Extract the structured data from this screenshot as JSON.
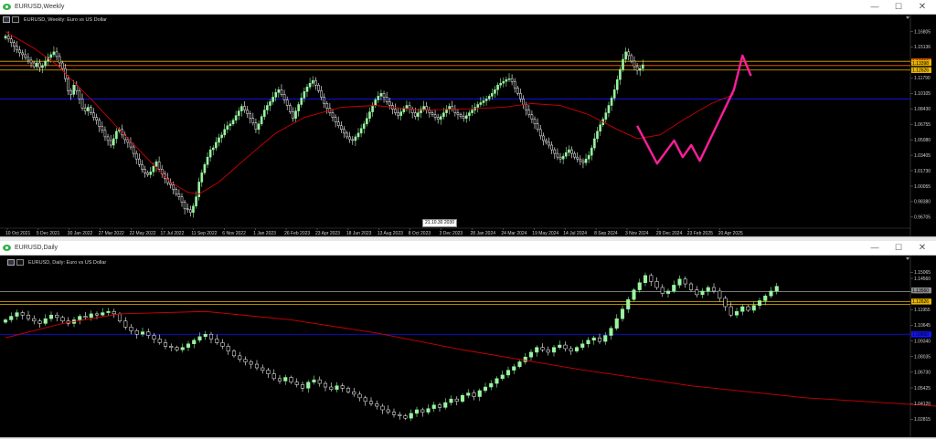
{
  "windows": [
    {
      "title": "EURUSD,Weekly",
      "header": "EURUSD, Weekly: Euro vs US Dollar",
      "controls": {
        "minimize": "—",
        "maximize": "☐",
        "close": "✕"
      },
      "time_tooltip": {
        "date": "21.10.30",
        "value": "2030"
      }
    },
    {
      "title": "EURUSD,Daily",
      "header": "EURUSD, Daily: Euro vs US Dollar",
      "controls": {
        "minimize": "—",
        "maximize": "☐",
        "close": "✕"
      }
    }
  ],
  "colors": {
    "background": "#000000",
    "bull_candle": "#98f5a0",
    "bear_candle": "#ffffff",
    "moving_average": "#d00000",
    "drawn_path": "#ff1e9b",
    "hline_yellow": "#e8b400",
    "hline_orange": "#ff6a00",
    "hline_blue": "#1414ff",
    "hline_gray": "#8a8a8a"
  },
  "chart_data": [
    {
      "type": "candlestick",
      "symbol": "EURUSD",
      "timeframe": "Weekly",
      "title": "Euro vs US Dollar",
      "x_tick_labels": [
        "10 Oct 2021",
        "5 Dec 2021",
        "30 Jan 2022",
        "27 Mar 2022",
        "22 May 2022",
        "17 Jul 2022",
        "11 Sep 2022",
        "6 Nov 2022",
        "1 Jan 2023",
        "26 Feb 2023",
        "23 Apr 2023",
        "18 Jun 2023",
        "13 Aug 2023",
        "8 Oct 2023",
        "3 Dec 2023",
        "28 Jan 2024",
        "24 Mar 2024",
        "19 May 2024",
        "14 Jul 2024",
        "8 Sep 2024",
        "3 Nov 2024",
        "29 Dec 2024",
        "23 Feb 2025",
        "20 Apr 2025"
      ],
      "y_tick_labels": [
        "1.16805",
        "1.15136",
        "1.13465",
        "1.11790",
        "1.10105",
        "1.08430",
        "1.06755",
        "1.05080",
        "1.03405",
        "1.01730",
        "1.00055",
        "0.98380",
        "0.96705"
      ],
      "ylim": [
        0.958,
        1.1765
      ],
      "price_tags": [
        {
          "value": "1.13559",
          "color": "#ff6a00"
        },
        {
          "value": "1.13398",
          "color": "#e8b400"
        },
        {
          "value": "1.12626",
          "color": "#e8b400"
        }
      ],
      "horizontal_lines": [
        {
          "value": 1.1358,
          "color": "#e8b400"
        },
        {
          "value": 1.1312,
          "color": "#ff6a00"
        },
        {
          "value": 1.1263,
          "color": "#e8b400"
        },
        {
          "value": 1.095,
          "color": "#1414ff"
        }
      ],
      "moving_average": [
        [
          0,
          1.168
        ],
        [
          10,
          1.15
        ],
        [
          18,
          1.132
        ],
        [
          30,
          1.095
        ],
        [
          40,
          1.062
        ],
        [
          50,
          1.03
        ],
        [
          58,
          1.005
        ],
        [
          64,
          0.994
        ],
        [
          68,
          0.992
        ],
        [
          75,
          1.005
        ],
        [
          85,
          1.032
        ],
        [
          95,
          1.058
        ],
        [
          105,
          1.075
        ],
        [
          118,
          1.086
        ],
        [
          130,
          1.088
        ],
        [
          145,
          1.083
        ],
        [
          160,
          1.084
        ],
        [
          175,
          1.086
        ],
        [
          185,
          1.09
        ],
        [
          195,
          1.088
        ],
        [
          205,
          1.078
        ],
        [
          215,
          1.062
        ],
        [
          222,
          1.052
        ],
        [
          230,
          1.056
        ],
        [
          238,
          1.072
        ],
        [
          248,
          1.09
        ],
        [
          256,
          1.1
        ]
      ],
      "drawn_path": [
        [
          222,
          1.066
        ],
        [
          229,
          1.025
        ],
        [
          235,
          1.05
        ],
        [
          238,
          1.032
        ],
        [
          241,
          1.045
        ],
        [
          244,
          1.028
        ],
        [
          256,
          1.105
        ],
        [
          259,
          1.142
        ],
        [
          262,
          1.12
        ]
      ],
      "series": [
        {
          "name": "EURUSD",
          "close": [
            1.163,
            1.16,
            1.156,
            1.152,
            1.148,
            1.145,
            1.143,
            1.14,
            1.137,
            1.134,
            1.13,
            1.134,
            1.129,
            1.131,
            1.136,
            1.14,
            1.143,
            1.146,
            1.141,
            1.134,
            1.128,
            1.117,
            1.104,
            1.1,
            1.11,
            1.104,
            1.095,
            1.085,
            1.082,
            1.086,
            1.08,
            1.075,
            1.072,
            1.065,
            1.061,
            1.054,
            1.05,
            1.045,
            1.052,
            1.06,
            1.062,
            1.056,
            1.051,
            1.048,
            1.043,
            1.036,
            1.03,
            1.024,
            1.019,
            1.015,
            1.013,
            1.016,
            1.022,
            1.027,
            1.019,
            1.014,
            1.009,
            1.004,
            1.002,
            0.997,
            0.992,
            0.989,
            0.983,
            0.976,
            0.975,
            0.972,
            0.979,
            0.989,
            1.005,
            1.015,
            1.024,
            1.032,
            1.04,
            1.042,
            1.048,
            1.053,
            1.056,
            1.062,
            1.066,
            1.068,
            1.072,
            1.077,
            1.082,
            1.087,
            1.083,
            1.079,
            1.074,
            1.069,
            1.062,
            1.068,
            1.076,
            1.083,
            1.088,
            1.092,
            1.097,
            1.102,
            1.105,
            1.1,
            1.094,
            1.088,
            1.081,
            1.074,
            1.082,
            1.089,
            1.096,
            1.103,
            1.108,
            1.112,
            1.115,
            1.11,
            1.104,
            1.097,
            1.09,
            1.085,
            1.08,
            1.075,
            1.07,
            1.066,
            1.062,
            1.058,
            1.054,
            1.051,
            1.05,
            1.054,
            1.058,
            1.063,
            1.068,
            1.074,
            1.081,
            1.088,
            1.094,
            1.098,
            1.101,
            1.097,
            1.092,
            1.088,
            1.084,
            1.08,
            1.077,
            1.081,
            1.085,
            1.088,
            1.084,
            1.08,
            1.076,
            1.08,
            1.084,
            1.087,
            1.083,
            1.08,
            1.078,
            1.075,
            1.073,
            1.076,
            1.08,
            1.084,
            1.087,
            1.084,
            1.08,
            1.078,
            1.076,
            1.074,
            1.077,
            1.08,
            1.083,
            1.086,
            1.089,
            1.091,
            1.093,
            1.095,
            1.098,
            1.101,
            1.105,
            1.11,
            1.112,
            1.114,
            1.116,
            1.117,
            1.114,
            1.107,
            1.101,
            1.095,
            1.089,
            1.083,
            1.078,
            1.073,
            1.068,
            1.062,
            1.055,
            1.05,
            1.048,
            1.045,
            1.04,
            1.036,
            1.032,
            1.03,
            1.033,
            1.037,
            1.04,
            1.036,
            1.032,
            1.03,
            1.028,
            1.026,
            1.03,
            1.034,
            1.042,
            1.052,
            1.06,
            1.067,
            1.073,
            1.08,
            1.088,
            1.096,
            1.105,
            1.116,
            1.127,
            1.138,
            1.146,
            1.142,
            1.136,
            1.13,
            1.126,
            1.128,
            1.132
          ]
        }
      ]
    },
    {
      "type": "candlestick",
      "symbol": "EURUSD",
      "timeframe": "Daily",
      "title": "Euro vs US Dollar",
      "y_tick_labels": [
        "1.15065",
        "1.14560",
        "1.13440",
        "1.11955",
        "1.10645",
        "1.09340",
        "1.08035",
        "1.06730",
        "1.05425",
        "1.04120",
        "1.02815"
      ],
      "ylim": [
        1.02,
        1.1555
      ],
      "price_tags": [
        {
          "value": "1.13560",
          "color": "#8a8a8a"
        },
        {
          "value": "1.12626",
          "color": "#e8b400"
        },
        {
          "value": "1.09890",
          "color": "#1414ff"
        }
      ],
      "horizontal_lines": [
        {
          "value": 1.1345,
          "color": "#8a8a8a"
        },
        {
          "value": 1.1262,
          "color": "#e8b400"
        },
        {
          "value": 1.1238,
          "color": "#e8b400"
        },
        {
          "value": 1.099,
          "color": "#1414ff"
        }
      ],
      "moving_average": [
        [
          0,
          1.096
        ],
        [
          10,
          1.108
        ],
        [
          20,
          1.116
        ],
        [
          35,
          1.118
        ],
        [
          50,
          1.111
        ],
        [
          65,
          1.1
        ],
        [
          80,
          1.086
        ],
        [
          100,
          1.07
        ],
        [
          120,
          1.056
        ],
        [
          140,
          1.046
        ],
        [
          160,
          1.04
        ],
        [
          175,
          1.035
        ],
        [
          195,
          1.034
        ],
        [
          215,
          1.038
        ],
        [
          235,
          1.048
        ],
        [
          255,
          1.064
        ],
        [
          270,
          1.08
        ],
        [
          285,
          1.1
        ],
        [
          300,
          1.12
        ],
        [
          315,
          1.133
        ],
        [
          330,
          1.132
        ]
      ],
      "drawn_path": [
        [
          292,
          1.105
        ],
        [
          297,
          1.142
        ],
        [
          304,
          1.131
        ],
        [
          310,
          1.148
        ],
        [
          315,
          1.133
        ],
        [
          320,
          1.142
        ],
        [
          324,
          1.133
        ],
        [
          330,
          1.141
        ],
        [
          336,
          1.134
        ],
        [
          342,
          1.127
        ],
        [
          347,
          1.11
        ],
        [
          352,
          1.123
        ],
        [
          356,
          1.116
        ],
        [
          360,
          1.122
        ],
        [
          366,
          1.128
        ],
        [
          372,
          1.138
        ]
      ],
      "series": [
        {
          "name": "EURUSD",
          "close": [
            1.111,
            1.114,
            1.117,
            1.115,
            1.112,
            1.11,
            1.108,
            1.112,
            1.115,
            1.113,
            1.11,
            1.108,
            1.111,
            1.114,
            1.113,
            1.116,
            1.115,
            1.117,
            1.118,
            1.116,
            1.11,
            1.105,
            1.102,
            1.099,
            1.101,
            1.098,
            1.095,
            1.092,
            1.089,
            1.088,
            1.086,
            1.088,
            1.091,
            1.094,
            1.097,
            1.099,
            1.095,
            1.092,
            1.089,
            1.085,
            1.081,
            1.078,
            1.076,
            1.074,
            1.071,
            1.069,
            1.066,
            1.062,
            1.06,
            1.063,
            1.059,
            1.057,
            1.054,
            1.059,
            1.061,
            1.058,
            1.055,
            1.053,
            1.056,
            1.054,
            1.051,
            1.049,
            1.046,
            1.043,
            1.041,
            1.039,
            1.036,
            1.034,
            1.032,
            1.031,
            1.029,
            1.033,
            1.036,
            1.034,
            1.037,
            1.04,
            1.038,
            1.042,
            1.045,
            1.043,
            1.048,
            1.05,
            1.047,
            1.052,
            1.055,
            1.058,
            1.062,
            1.065,
            1.069,
            1.072,
            1.076,
            1.08,
            1.084,
            1.088,
            1.086,
            1.084,
            1.088,
            1.09,
            1.087,
            1.085,
            1.088,
            1.091,
            1.094,
            1.096,
            1.093,
            1.098,
            1.104,
            1.112,
            1.12,
            1.128,
            1.136,
            1.142,
            1.148,
            1.143,
            1.138,
            1.133,
            1.135,
            1.14,
            1.145,
            1.141,
            1.136,
            1.132,
            1.135,
            1.138,
            1.135,
            1.129,
            1.122,
            1.115,
            1.118,
            1.122,
            1.119,
            1.123,
            1.127,
            1.131,
            1.135,
            1.139
          ]
        }
      ]
    }
  ]
}
